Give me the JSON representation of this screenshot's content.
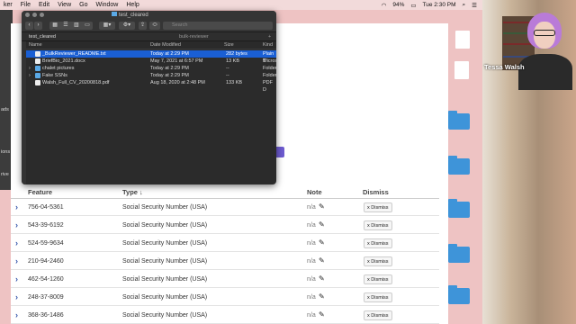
{
  "menubar": {
    "items": [
      "ker",
      "File",
      "Edit",
      "View",
      "Go",
      "Window",
      "Help"
    ],
    "battery": "94%",
    "clock": "Tue 2:30 PM"
  },
  "leftstrip": [
    "ads",
    "ions",
    "rive"
  ],
  "finder": {
    "window_title": "test_cleared",
    "search_placeholder": "Search",
    "tabs": [
      "test_cleared",
      "bulk-reviewer"
    ],
    "columns": {
      "name": "Name",
      "date": "Date Modified",
      "size": "Size",
      "kind": "Kind"
    },
    "files": [
      {
        "name": "_BulkReviewer_README.txt",
        "date": "Today at 2:29 PM",
        "size": "282 bytes",
        "kind": "Plain T",
        "icon": "doc"
      },
      {
        "name": "BriefBio_2021.docx",
        "date": "May 7, 2021 at 6:57 PM",
        "size": "13 KB",
        "kind": "Micros",
        "icon": "doc"
      },
      {
        "name": "chalet pictures",
        "date": "Today at 2:29 PM",
        "size": "--",
        "kind": "Folder",
        "icon": "fold"
      },
      {
        "name": "Fake SSNs",
        "date": "Today at 2:29 PM",
        "size": "--",
        "kind": "Folder",
        "icon": "fold"
      },
      {
        "name": "Walsh_Full_CV_20200818.pdf",
        "date": "Aug 18, 2020 at 2:48 PM",
        "size": "133 KB",
        "kind": "PDF D",
        "icon": "doc"
      }
    ]
  },
  "table": {
    "headers": {
      "feature": "Feature",
      "type": "Type ↓",
      "note": "Note",
      "dismiss": "Dismiss"
    },
    "rows": [
      {
        "feature": "756-04-5361",
        "type": "Social Security Number (USA)",
        "note": "n/a",
        "dismiss": "x Dismiss"
      },
      {
        "feature": "543-39-6192",
        "type": "Social Security Number (USA)",
        "note": "n/a",
        "dismiss": "x Dismiss"
      },
      {
        "feature": "524-59-9634",
        "type": "Social Security Number (USA)",
        "note": "n/a",
        "dismiss": "x Dismiss"
      },
      {
        "feature": "210-94-2460",
        "type": "Social Security Number (USA)",
        "note": "n/a",
        "dismiss": "x Dismiss"
      },
      {
        "feature": "462-54-1260",
        "type": "Social Security Number (USA)",
        "note": "n/a",
        "dismiss": "x Dismiss"
      },
      {
        "feature": "248-37-8009",
        "type": "Social Security Number (USA)",
        "note": "n/a",
        "dismiss": "x Dismiss"
      },
      {
        "feature": "368-36-1486",
        "type": "Social Security Number (USA)",
        "note": "n/a",
        "dismiss": "x Dismiss"
      }
    ]
  },
  "webcam": {
    "name": "Tessa Walsh"
  }
}
